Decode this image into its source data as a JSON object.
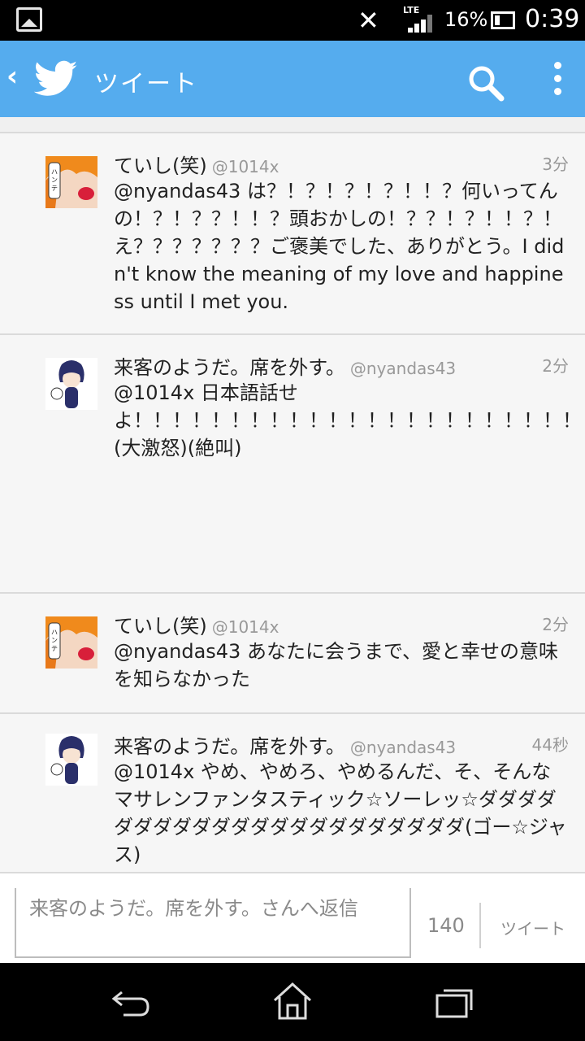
{
  "status_bar": {
    "network": "LTE",
    "battery": "16%",
    "time": "0:39"
  },
  "app_bar": {
    "title": "ツイート"
  },
  "tweets": [
    {
      "name": "ていし(笑)",
      "handle": "@1014x",
      "time": "3分",
      "text": "@nyandas43 は？！？！？！？！！？何いってんの！？！？？！！？頭おかしの！？？！？！！？！え？？？？？？？ご褒美でした、ありがとう。I didn't know the meaning of my love and happiness until I met you.",
      "avatar": "orange-hair-avatar"
    },
    {
      "name": "来客のようだ。席を外す。",
      "handle": "@nyandas43",
      "time": "2分",
      "text": "@1014x 日本語話せよ！！！！！！！！！！！！！！！！！！！！！！！！！！！！！！！！！！！！！！！！！！！！！！！！！！！！！！！！！！！！！！！！！！！！！！！！！！！！！！！！！！！！！！！！！！！！！！！！！！！！(大激怒)(絶叫)",
      "avatar": "blue-hair-chibi-avatar"
    },
    {
      "name": "ていし(笑)",
      "handle": "@1014x",
      "time": "2分",
      "text": "@nyandas43 あなたに会うまで、愛と幸せの意味を知らなかった",
      "avatar": "orange-hair-avatar"
    },
    {
      "name": "来客のようだ。席を外す。",
      "handle": "@nyandas43",
      "time": "44秒",
      "text": "@1014x やめ、やめろ、やめるんだ、そ、そんなマサレンファンタスティック☆ソーレッ☆ダダダダダダダダダダダダダダダダダダダダダダ(ゴー☆ジャス)",
      "avatar": "blue-hair-chibi-avatar"
    }
  ],
  "reply": {
    "placeholder": "来客のようだ。席を外す。さんへ返信",
    "counter": "140",
    "tweet_button": "ツイート"
  },
  "colors": {
    "brand": "#55acee",
    "handle_gray": "#999999"
  }
}
